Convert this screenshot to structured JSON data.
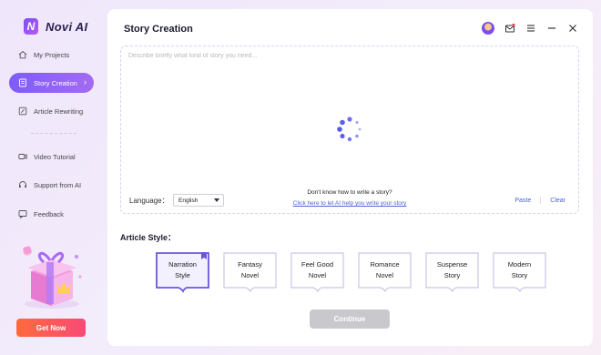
{
  "app": {
    "name": "Novi AI"
  },
  "sidebar": {
    "items": [
      {
        "label": "My Projects",
        "icon": "home-icon"
      },
      {
        "label": "Story Creation",
        "icon": "book-icon",
        "active": true
      },
      {
        "label": "Article Rewriting",
        "icon": "rewrite-icon"
      },
      {
        "label": "Video Tutorial",
        "icon": "video-icon"
      },
      {
        "label": "Support from AI",
        "icon": "headset-icon"
      },
      {
        "label": "Feedback",
        "icon": "feedback-icon"
      }
    ],
    "get_now_label": "Get Now"
  },
  "main": {
    "title": "Story Creation",
    "story_input": {
      "placeholder": "Describe briefly what kind of story you need...",
      "value": ""
    },
    "language": {
      "label": "Language：",
      "selected": "English"
    },
    "help": {
      "question": "Don't know how to write a story?",
      "link": "Click here to let AI help you write your story"
    },
    "actions": {
      "paste": "Paste",
      "clear": "Clear"
    },
    "article_style_label": "Article Style：",
    "styles": [
      {
        "line1": "Narration",
        "line2": "Style",
        "selected": true
      },
      {
        "line1": "Fantasy",
        "line2": "Novel"
      },
      {
        "line1": "Feel Good",
        "line2": "Novel"
      },
      {
        "line1": "Romance",
        "line2": "Novel"
      },
      {
        "line1": "Suspense",
        "line2": "Story"
      },
      {
        "line1": "Modern",
        "line2": "Story"
      }
    ],
    "continue_label": "Continue"
  },
  "colors": {
    "accent": "#7e5cf7",
    "link": "#4b63d8",
    "cta": "#f84a76",
    "disabled": "#c9c9cd"
  }
}
